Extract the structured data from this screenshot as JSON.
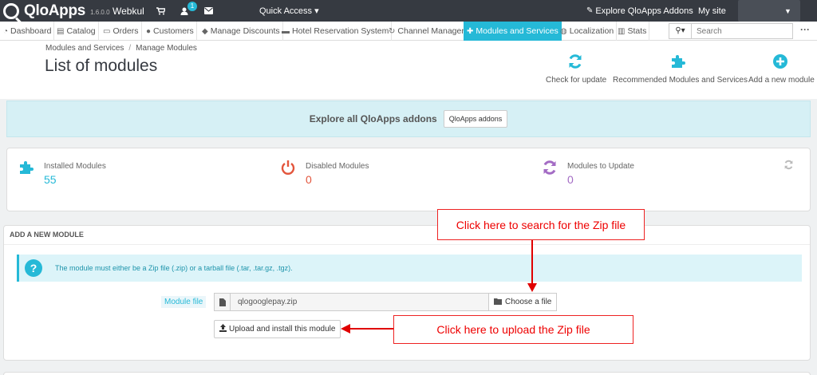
{
  "topbar": {
    "brand": "QloApps",
    "version": "1.6.0.0",
    "shop_name": "Webkul",
    "notification_count": "1",
    "quick_access": "Quick Access ▾",
    "explore_addons": "Explore QloApps Addons",
    "my_site": "My site"
  },
  "nav": {
    "items": [
      {
        "icon": "dashboard-icon",
        "label": "Dashboard"
      },
      {
        "icon": "catalog-icon",
        "label": "Catalog"
      },
      {
        "icon": "orders-icon",
        "label": "Orders"
      },
      {
        "icon": "customers-icon",
        "label": "Customers"
      },
      {
        "icon": "tag-icon",
        "label": "Manage Discounts"
      },
      {
        "icon": "bed-icon",
        "label": "Hotel Reservation System"
      },
      {
        "icon": "refresh-icon",
        "label": "Channel Manager"
      },
      {
        "icon": "puzzle-icon",
        "label": "Modules and Services"
      },
      {
        "icon": "globe-icon",
        "label": "Localization"
      },
      {
        "icon": "bar-chart-icon",
        "label": "Stats"
      }
    ],
    "search_placeholder": "Search"
  },
  "header": {
    "breadcrumb": [
      "Modules and Services",
      "Manage Modules"
    ],
    "breadcrumb_sep": "/",
    "title": "List of modules",
    "toolbar": [
      {
        "icon": "refresh-icon",
        "label": "Check for update"
      },
      {
        "icon": "puzzle-icon",
        "label": "Recommended Modules and Services"
      },
      {
        "icon": "plus-circle-icon",
        "label": "Add a new module"
      }
    ]
  },
  "explore": {
    "text": "Explore all QloApps addons",
    "button": "QloApps addons"
  },
  "stats": [
    {
      "label": "Installed Modules",
      "value": "55",
      "color": "#25b9d7"
    },
    {
      "label": "Disabled Modules",
      "value": "0",
      "color": "#e3553c"
    },
    {
      "label": "Modules to Update",
      "value": "0",
      "color": "#a36bc4"
    }
  ],
  "add_module": {
    "heading": "ADD A NEW MODULE",
    "info": "The module must either be a Zip file (.zip) or a tarball file (.tar, .tar.gz, .tgz).",
    "file_label": "Module file",
    "file_value": "qlogooglepay.zip",
    "choose_button": "Choose a file",
    "upload_button": "Upload and install this module"
  },
  "annotations": {
    "search_zip": "Click here to search for the Zip file",
    "upload_zip": "Click here to upload the Zip file",
    "color": "#e00000"
  }
}
